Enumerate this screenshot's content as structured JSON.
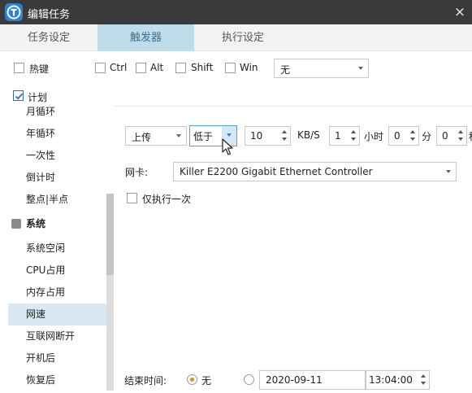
{
  "window": {
    "title": "编辑任务",
    "close_glyph": "×"
  },
  "tabs": [
    {
      "label": "任务设定",
      "active": false
    },
    {
      "label": "触发器",
      "active": true
    },
    {
      "label": "执行设定",
      "active": false
    }
  ],
  "hotkey": {
    "label": "热键",
    "checked": false,
    "modifiers": [
      "Ctrl",
      "Alt",
      "Shift",
      "Win"
    ],
    "key_value": "无"
  },
  "sidebar": {
    "plan_label": "计划",
    "plan_checked": true,
    "plan_items": [
      "月循环",
      "年循环",
      "一次性",
      "倒计时",
      "整点|半点"
    ],
    "system_label": "系统",
    "system_items": [
      "系统空闲",
      "CPU占用",
      "内存占用",
      "网速",
      "互联网断开",
      "开机后",
      "恢复后"
    ],
    "selected": "网速"
  },
  "network": {
    "direction": "上传",
    "comparison": "低于",
    "speed_value": "10",
    "speed_unit": "KB/S",
    "hours_value": "1",
    "hours_unit": "小时",
    "minutes_value": "0",
    "minutes_unit": "分",
    "seconds_value": "0",
    "seconds_unit_partial": "秒",
    "adapter_label": "网卡:",
    "adapter_value": "Killer E2200 Gigabit Ethernet Controller",
    "once_label": "仅执行一次",
    "once_checked": false
  },
  "end_time": {
    "label": "结束时间:",
    "none_label": "无",
    "none_selected": true,
    "date_value": "2020-09-11",
    "time_value": "13:04:00"
  },
  "colors": {
    "titlebar": "#3a3a3a",
    "accent_tab": "#bfdcea",
    "selected_item": "#d9e8f3",
    "check": "#2a6fb4",
    "radio_dot": "#e08a1c"
  }
}
